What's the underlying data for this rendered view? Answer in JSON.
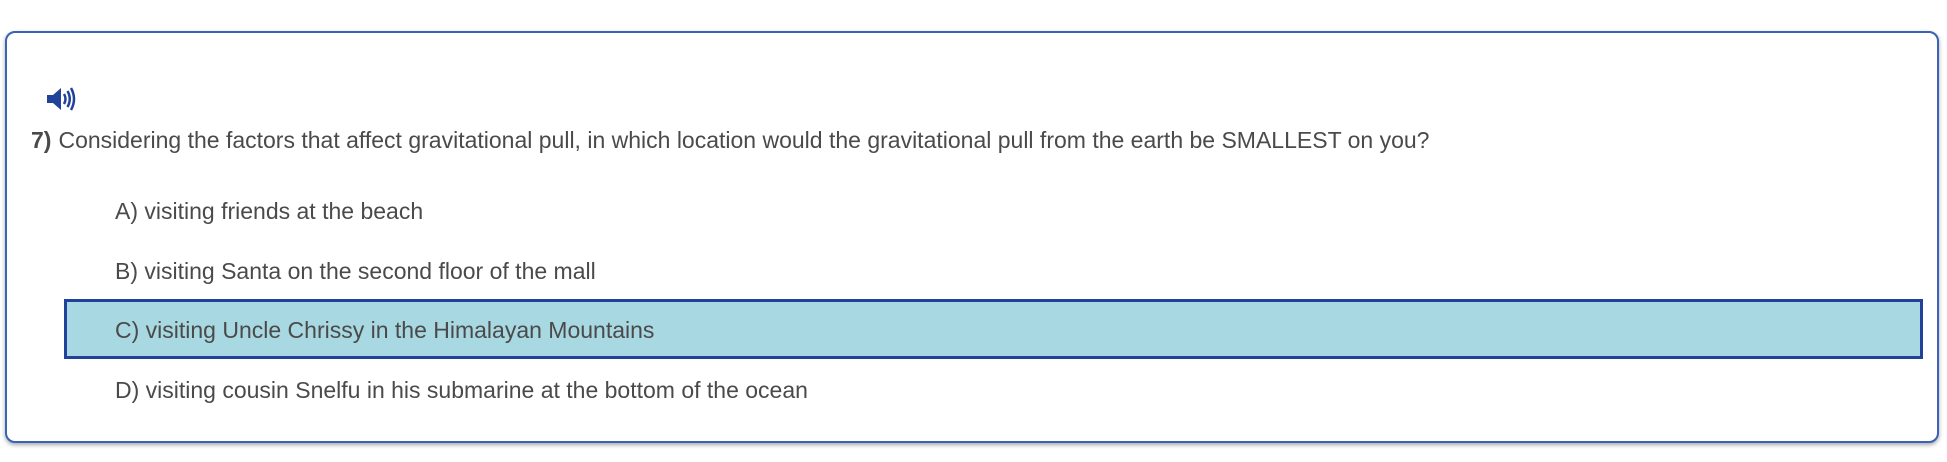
{
  "question": {
    "number": "7)",
    "text": "Considering the factors that affect gravitational pull, in which location would the gravitational pull from the earth be SMALLEST on you?",
    "audio_icon": "speaker-icon",
    "accent_color": "#21419a"
  },
  "options": [
    {
      "label": "A) visiting friends at the beach",
      "selected": false
    },
    {
      "label": "B) visiting Santa on the second floor of the mall",
      "selected": false
    },
    {
      "label": "C) visiting Uncle Chrissy in the Himalayan Mountains",
      "selected": true
    },
    {
      "label": "D) visiting cousin Snelfu in his submarine at the bottom of the ocean",
      "selected": false
    }
  ],
  "colors": {
    "selected_background": "#a8d8e2",
    "selected_border": "#21419a",
    "card_border": "#3a62b8",
    "text": "#4a4a4a"
  }
}
